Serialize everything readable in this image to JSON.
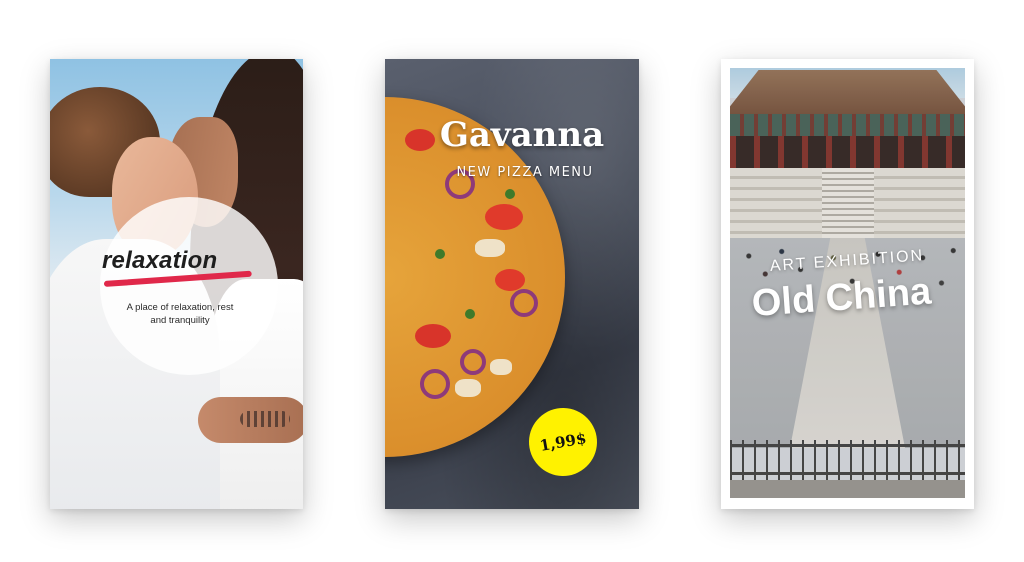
{
  "cards": [
    {
      "title": "relaxation",
      "subtitle": "A place of relaxation, rest and tranquility",
      "accent_color": "#e0284a"
    },
    {
      "title": "Gavanna",
      "subtitle": "NEW PIZZA MENU",
      "price": "1,99$",
      "price_badge_color": "#fff200"
    },
    {
      "eyebrow": "ART EXHIBITION",
      "title": "Old China"
    }
  ]
}
